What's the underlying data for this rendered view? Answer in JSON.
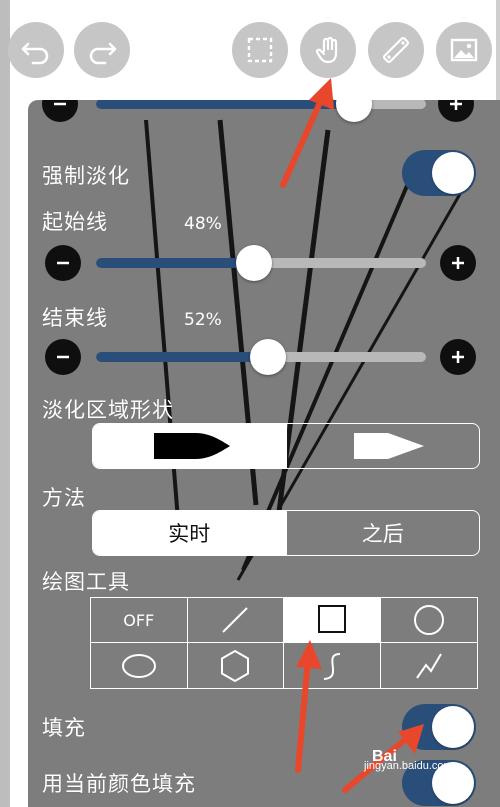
{
  "toolbar": {
    "buttons": [
      {
        "name": "undo",
        "icon": "undo-arrow-icon"
      },
      {
        "name": "redo",
        "icon": "redo-arrow-icon"
      },
      {
        "name": "selection",
        "icon": "dashed-selection-icon"
      },
      {
        "name": "hand",
        "icon": "hand-pointer-icon"
      },
      {
        "name": "ruler",
        "icon": "ruler-icon"
      },
      {
        "name": "image",
        "icon": "image-icon"
      }
    ]
  },
  "panel": {
    "force_fade": {
      "label": "强制淡化",
      "enabled": true
    },
    "start_line": {
      "label": "起始线",
      "value_text": "48%",
      "value": 0.48
    },
    "end_line": {
      "label": "结束线",
      "value_text": "52%",
      "value": 0.52
    },
    "fade_shape": {
      "label": "淡化区域形状",
      "options": [
        "rounded-bullet-shape",
        "pointed-shape"
      ],
      "selected": 0
    },
    "method": {
      "label": "方法",
      "options": [
        "实时",
        "之后"
      ],
      "selected": 0
    },
    "draw_tool": {
      "label": "绘图工具",
      "tools": [
        {
          "name": "off",
          "text": "OFF"
        },
        {
          "name": "line",
          "icon": "line-icon"
        },
        {
          "name": "rectangle",
          "icon": "rectangle-icon"
        },
        {
          "name": "circle",
          "icon": "circle-icon"
        },
        {
          "name": "ellipse",
          "icon": "ellipse-icon"
        },
        {
          "name": "polygon",
          "icon": "hexagon-icon"
        },
        {
          "name": "curve",
          "icon": "curve-icon"
        },
        {
          "name": "polyline",
          "icon": "polyline-icon"
        }
      ],
      "selected": "rectangle"
    },
    "fill": {
      "label": "填充",
      "enabled": true
    },
    "fill_current_color": {
      "label": "用当前颜色填充",
      "enabled": true
    }
  },
  "colors": {
    "panel": "#7d7d7d",
    "accent": "#2a4e7a",
    "annotation_arrow": "#e8472b"
  },
  "watermark": {
    "brand": "Bai",
    "url": "jingyan.baidu.com"
  }
}
